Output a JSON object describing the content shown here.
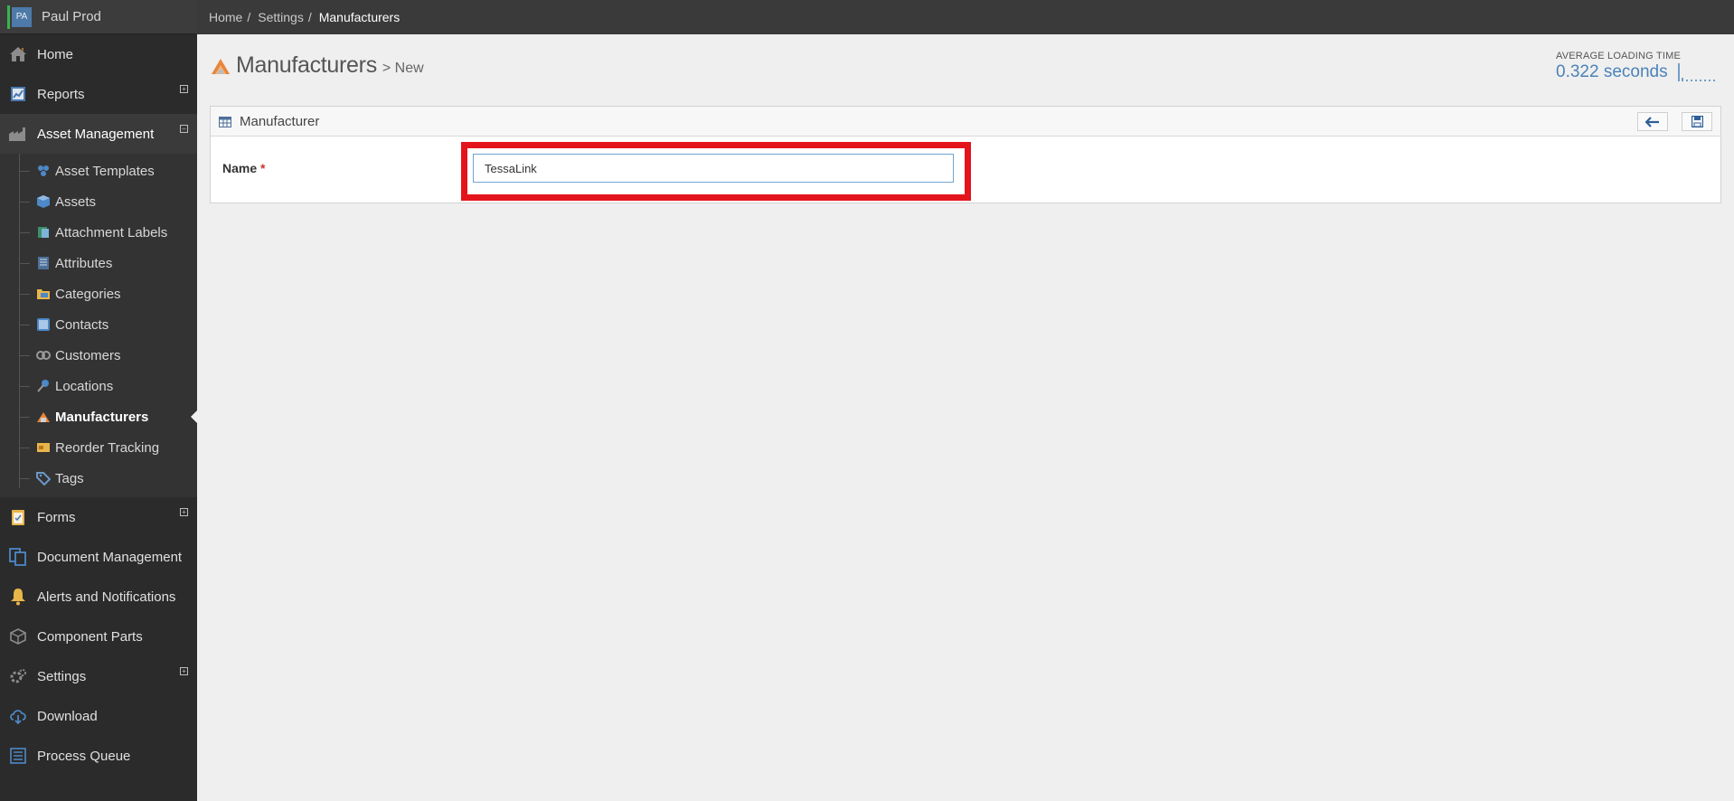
{
  "user": {
    "initials": "PA",
    "name": "Paul Prod"
  },
  "nav": {
    "home": "Home",
    "reports": "Reports",
    "asset_management": "Asset Management",
    "forms": "Forms",
    "document_management": "Document Management",
    "alerts": "Alerts and Notifications",
    "component_parts": "Component Parts",
    "settings": "Settings",
    "download": "Download",
    "process_queue": "Process Queue"
  },
  "submenu": {
    "items": [
      {
        "label": "Asset Templates",
        "icon": "cubes-icon"
      },
      {
        "label": "Assets",
        "icon": "cube-icon"
      },
      {
        "label": "Attachment Labels",
        "icon": "label-icon"
      },
      {
        "label": "Attributes",
        "icon": "list-icon"
      },
      {
        "label": "Categories",
        "icon": "folder-icon"
      },
      {
        "label": "Contacts",
        "icon": "contact-card-icon"
      },
      {
        "label": "Customers",
        "icon": "customers-icon"
      },
      {
        "label": "Locations",
        "icon": "pin-icon"
      },
      {
        "label": "Manufacturers",
        "icon": "factory-icon",
        "active": true
      },
      {
        "label": "Reorder Tracking",
        "icon": "reorder-icon"
      },
      {
        "label": "Tags",
        "icon": "tag-icon"
      }
    ]
  },
  "breadcrumb": {
    "home": "Home",
    "settings": "Settings",
    "current": "Manufacturers",
    "separator": "/"
  },
  "page": {
    "title": "Manufacturers",
    "subtitle": "> New"
  },
  "loading": {
    "title": "AVERAGE LOADING TIME",
    "value": "0.322 seconds"
  },
  "widget": {
    "title": "Manufacturer"
  },
  "form": {
    "name_label": "Name",
    "required_marker": "*",
    "name_value": "TessaLink"
  },
  "colors": {
    "highlight": "#e4141c",
    "accent": "#4b82ba",
    "sidebar": "#2b2b2b"
  }
}
